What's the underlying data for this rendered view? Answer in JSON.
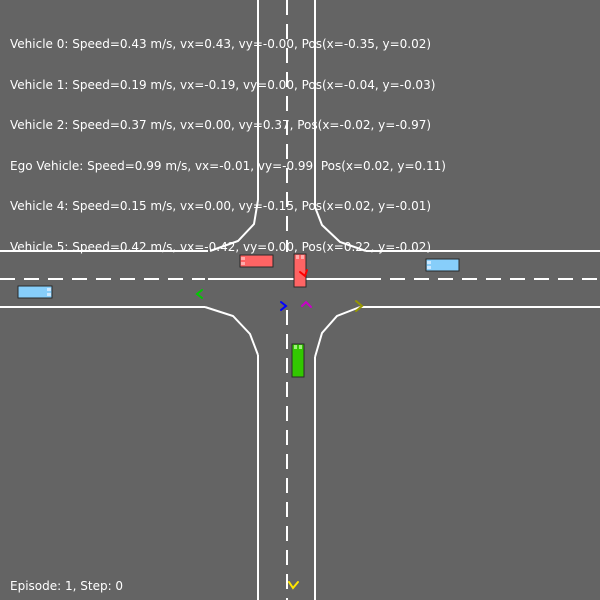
{
  "hud": {
    "lines": [
      "Vehicle 0: Speed=0.43 m/s, vx=0.43, vy=-0.00, Pos(x=-0.35, y=0.02)",
      "Vehicle 1: Speed=0.19 m/s, vx=-0.19, vy=0.00, Pos(x=-0.04, y=-0.03)",
      "Vehicle 2: Speed=0.37 m/s, vx=0.00, vy=0.37, Pos(x=-0.02, y=-0.97)",
      "Ego Vehicle: Speed=0.99 m/s, vx=-0.01, vy=-0.99, Pos(x=0.02, y=0.11)",
      "Vehicle 4: Speed=0.15 m/s, vx=0.00, vy=-0.15, Pos(x=0.02, y=-0.01)",
      "Vehicle 5: Speed=0.42 m/s, vx=-0.42, vy=0.00, Pos(x=0.22, y=-0.02)"
    ],
    "episode": "Episode: 1, Step: 0"
  },
  "colors": {
    "background": "#646464",
    "road_line": "#ffffff",
    "vehicle_blue": "#87cefa",
    "vehicle_red": "#ff6464",
    "vehicle_green": "#32c800",
    "marker_blue": "#0000ff",
    "marker_magenta": "#c800c8",
    "marker_green": "#00c800",
    "marker_olive": "#969600",
    "marker_yellow": "#ffe600",
    "marker_red": "#ff0000"
  }
}
